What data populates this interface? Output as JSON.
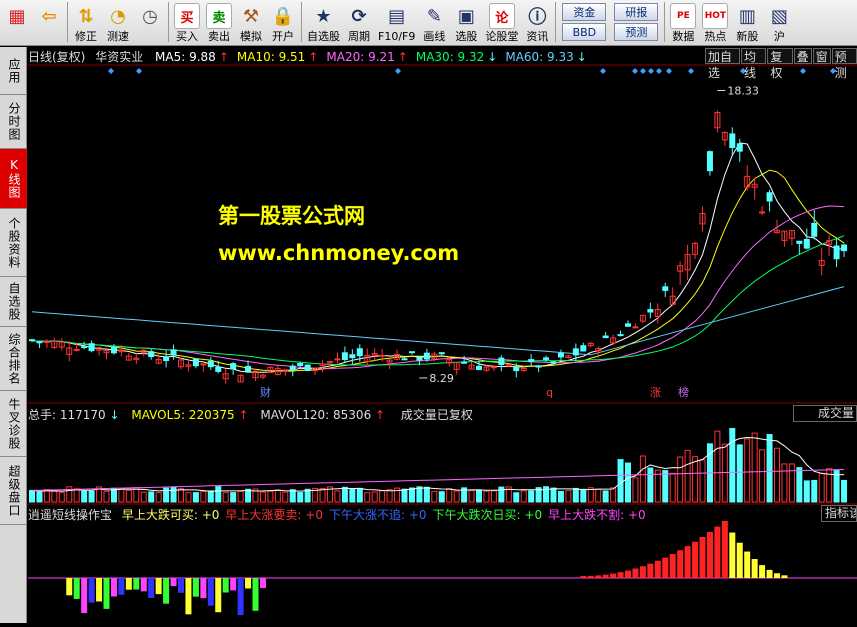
{
  "toolbar": {
    "buttons": [
      {
        "label": "",
        "icon": "grid-icon"
      },
      {
        "label": "",
        "icon": "back-arrow-icon"
      },
      {
        "label": "修正",
        "icon": "up-down-arrow-icon"
      },
      {
        "label": "测速",
        "icon": "speed-icon"
      },
      {
        "label": "",
        "icon": "clock-icon"
      },
      {
        "label": "买入",
        "icon_text": "买"
      },
      {
        "label": "卖出",
        "icon_text": "卖"
      },
      {
        "label": "模拟",
        "icon": "hammer-icon"
      },
      {
        "label": "开户",
        "icon": "lock-icon"
      },
      {
        "label": "自选股",
        "icon": "star-icon"
      },
      {
        "label": "周期",
        "icon": "cycle-icon"
      },
      {
        "label": "F10/F9",
        "icon": "document-icon"
      },
      {
        "label": "画线",
        "icon": "pen-icon"
      },
      {
        "label": "选股",
        "icon": "screen-icon"
      },
      {
        "label": "论股堂",
        "icon_text": "论"
      },
      {
        "label": "资讯",
        "icon": "info-icon"
      }
    ],
    "pills_left": [
      "资金",
      "BBD"
    ],
    "pills_right": [
      "研报",
      "预测"
    ],
    "right_buttons": [
      {
        "label": "数据",
        "icon_text": "PE"
      },
      {
        "label": "热点",
        "icon_text": "HOT"
      },
      {
        "label": "新股",
        "icon": "new-stock-icon"
      },
      {
        "label": "沪",
        "icon": "sh-icon"
      }
    ]
  },
  "side_tabs": [
    {
      "label": "应用",
      "active": false
    },
    {
      "label": "分时图",
      "active": false
    },
    {
      "label": "K线图",
      "active": true
    },
    {
      "label": "个股资料",
      "active": false
    },
    {
      "label": "自选股",
      "active": false
    },
    {
      "label": "综合排名",
      "active": false
    },
    {
      "label": "牛叉诊股",
      "active": false
    },
    {
      "label": "超级盘口",
      "active": false
    }
  ],
  "chart_header": {
    "period": "日线(复权)",
    "stock": "华资实业",
    "ma": [
      {
        "label": "MA5: 9.88",
        "arrow": "↑",
        "color": "#ffffff"
      },
      {
        "label": "MA10: 9.51",
        "arrow": "↑",
        "color": "#ffff00"
      },
      {
        "label": "MA20: 9.21",
        "arrow": "↑",
        "color": "#ff66ff"
      },
      {
        "label": "MA30: 9.32",
        "arrow": "↓",
        "color": "#00ff66"
      },
      {
        "label": "MA60: 9.33",
        "arrow": "↓",
        "color": "#66ccff"
      }
    ],
    "tabs": [
      "加自选",
      "均线",
      "复权",
      "叠",
      "窗",
      "预测"
    ]
  },
  "watermark": {
    "line1": "第一股票公式网",
    "line2": "www.chnmoney.com"
  },
  "price_labels": {
    "high": "18.33",
    "low": "8.29"
  },
  "event_marks": [
    {
      "text": "财",
      "color": "#6688ff"
    },
    {
      "text": "q",
      "color": "#ff3333"
    },
    {
      "text": "涨",
      "color": "#ff3333"
    },
    {
      "text": "榜",
      "color": "#cc66ff"
    }
  ],
  "volume_header": {
    "total": "总手: 117170",
    "total_arrow": "↓",
    "mavol5": "MAVOL5: 220375",
    "mavol5_arrow": "↑",
    "mavol120": "MAVOL120: 85306",
    "mavol120_arrow": "↑",
    "note": "成交量已复权",
    "tab": "成交量"
  },
  "indicator_header": {
    "name": "逍遥短线操作宝",
    "items": [
      {
        "label": "早上大跌可买: +0",
        "color": "#ffff66"
      },
      {
        "label": "早上大涨要卖: +0",
        "color": "#ff3333"
      },
      {
        "label": "下午大涨不追: +0",
        "color": "#3366ff"
      },
      {
        "label": "下午大跌次日买: +0",
        "color": "#33ff33"
      },
      {
        "label": "早上大跌不割: +0",
        "color": "#ff44ff"
      }
    ],
    "tab": "指标该"
  },
  "colors": {
    "up": "#ff3232",
    "down": "#54ffff",
    "ma5": "#ffffff",
    "ma10": "#ffff00",
    "ma20": "#ff66ff",
    "ma30": "#00ff66",
    "ma60": "#66ccff"
  }
}
